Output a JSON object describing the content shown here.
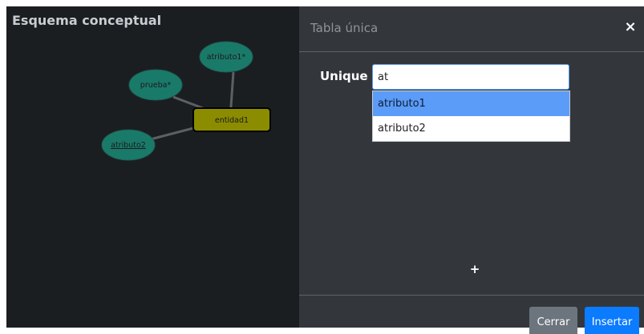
{
  "left_panel": {
    "title": "Esquema conceptual",
    "diagram": {
      "entity": {
        "label": "entidad1"
      },
      "attributes": [
        {
          "label": "atributo1*"
        },
        {
          "label": "prueba*"
        },
        {
          "label": "atributo2"
        }
      ]
    }
  },
  "modal": {
    "title": "Tabla única",
    "close_symbol": "×",
    "field_label": "Unique",
    "input_value": "at",
    "dropdown_options": [
      "atributo1",
      "atributo2"
    ],
    "add_symbol": "+",
    "buttons": {
      "close": "Cerrar",
      "insert": "Insertar"
    }
  },
  "colors": {
    "left_panel_bg": "#1b1e21",
    "modal_bg": "#33373c",
    "attribute_fill": "#1a7a6a",
    "entity_fill": "#8c8c00",
    "dropdown_highlight": "#5b9cf8",
    "insert_button": "#0b7bff",
    "close_button": "#6c757d"
  }
}
